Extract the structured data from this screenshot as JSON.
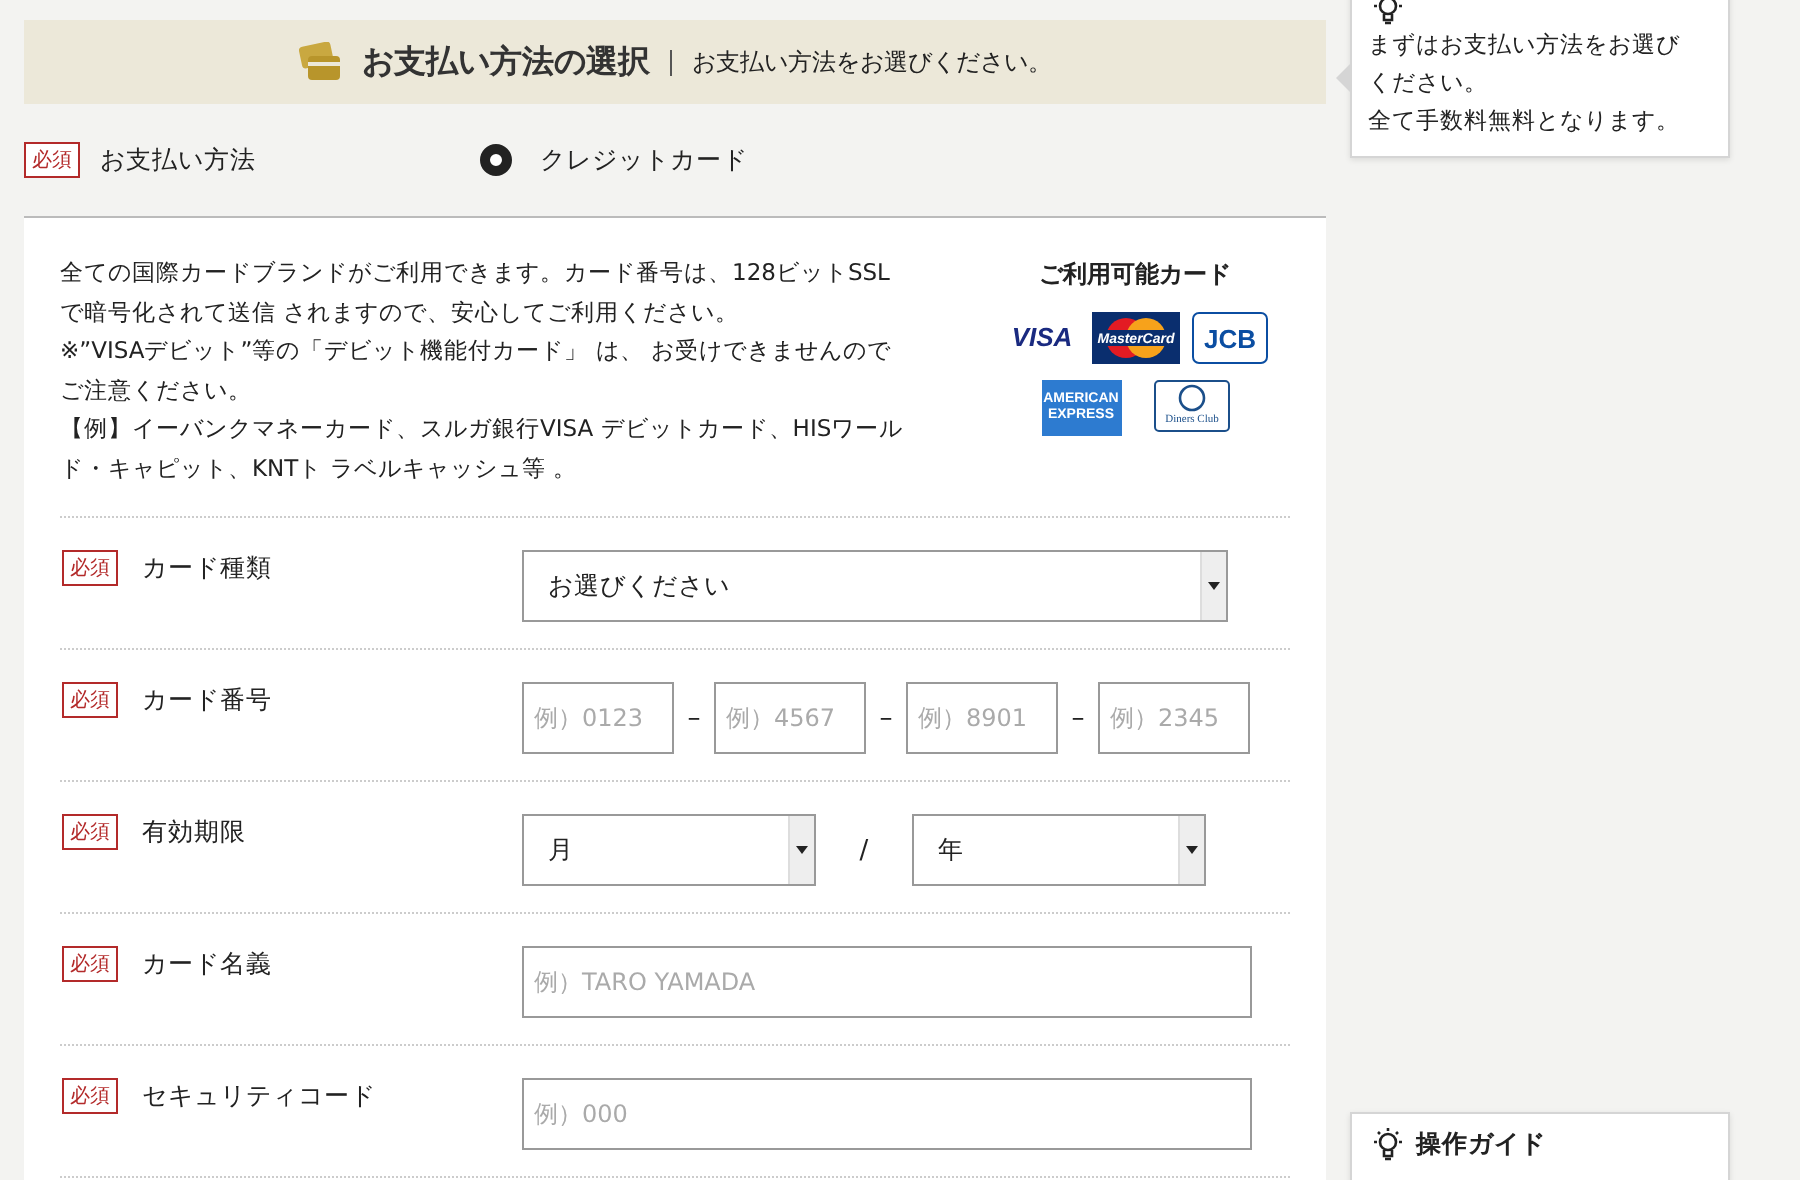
{
  "header": {
    "title": "お支払い方法の選択",
    "subtitle": "お支払い方法をお選びください。"
  },
  "payment_method": {
    "required_badge": "必須",
    "label": "お支払い方法",
    "options": [
      {
        "label": "クレジットカード",
        "selected": true
      }
    ]
  },
  "notice": {
    "lines": [
      "全ての国際カードブランドがご利用できます。カード番号は、128ビットSSL",
      "で暗号化されて送信 されますので、安心してご利用ください。",
      "※”VISAデビット”等の「デビット機能付カード」 は、 お受けできませんので",
      "ご注意ください。",
      "【例】イーバンクマネーカード、スルガ銀行VISA デビットカード、HISワール",
      "ド・キャピット、KNTト ラベルキャッシュ等 。"
    ]
  },
  "accepted_cards": {
    "title": "ご利用可能カード",
    "cards": [
      {
        "kind": "visa",
        "label": "VISA"
      },
      {
        "kind": "mastercard",
        "label": "MasterCard"
      },
      {
        "kind": "jcb",
        "label": "JCB"
      },
      {
        "kind": "amex",
        "label": "AMERICAN EXPRESS"
      },
      {
        "kind": "diners",
        "label": "Diners Club"
      }
    ]
  },
  "form_rows": [
    {
      "required_badge": "必須",
      "label": "カード種類",
      "kind": "select",
      "value": "お選びください"
    },
    {
      "required_badge": "必須",
      "label": "カード番号",
      "kind": "split_input",
      "separator": "–",
      "placeholders": [
        "例）0123",
        "例）4567",
        "例）8901",
        "例）2345"
      ]
    },
    {
      "required_badge": "必須",
      "label": "有効期限",
      "kind": "date_select",
      "separator": "/",
      "values": [
        "月",
        "年"
      ]
    },
    {
      "required_badge": "必須",
      "label": "カード名義",
      "kind": "input",
      "placeholder": "例）TARO YAMADA"
    },
    {
      "required_badge": "必須",
      "label": "セキュリティコード",
      "kind": "input",
      "placeholder": "例）000"
    }
  ],
  "guides": [
    {
      "body": [
        "まずはお支払い方法をお選び",
        "ください。",
        "全て手数料無料となります。"
      ]
    },
    {
      "title": "操作ガイド"
    }
  ]
}
